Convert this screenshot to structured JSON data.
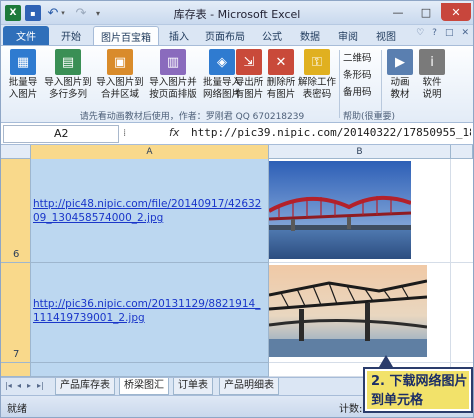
{
  "titlebar": {
    "title": "库存表 - Microsoft Excel",
    "min": "—",
    "max": "□",
    "close": "✕"
  },
  "qat": {
    "app": "X",
    "save": "▪",
    "undo": "↶",
    "redo": "↷",
    "more": "▾"
  },
  "tabs": [
    "文件",
    "开始",
    "图片百宝箱",
    "插入",
    "页面布局",
    "公式",
    "数据",
    "审阅",
    "视图"
  ],
  "ribbon_right": [
    "♡",
    "?",
    "□",
    "✕"
  ],
  "ribbon": {
    "buttons": [
      {
        "label": "批量导\n入图片",
        "color": "#2f7bd0"
      },
      {
        "label": "导入图片到\n多行多列",
        "color": "#3a8f55"
      },
      {
        "label": "导入图片到\n合并区域",
        "color": "#d98b2b"
      },
      {
        "label": "导入图片并\n按页面排版",
        "color": "#8a6bbd"
      },
      {
        "label": "批量导入\n网络图片",
        "color": "#2f7bd0"
      },
      {
        "label": "导出所\n有图片",
        "color": "#c94a3a"
      },
      {
        "label": "删除所\n有图片",
        "color": "#c94a3a"
      },
      {
        "label": "解除工作\n表密码",
        "color": "#e0b020"
      },
      {
        "label": "动画\n教材",
        "color": "#5a7fb0"
      },
      {
        "label": "软件\n说明",
        "color": "#7a7a7a"
      }
    ],
    "group_label": "请先看动画教材后使用，作者：罗刚君 QQ 670218239",
    "small_links": [
      "二维码",
      "条形码",
      "备用码"
    ],
    "help_label": "帮助(很重要)"
  },
  "formula_bar": {
    "name_box": "A2",
    "fx": "fx",
    "value": "http://pic39.nipic.com/20140322/17850955_180555"
  },
  "columns": [
    "A",
    "B"
  ],
  "rows": [
    {
      "num": "6",
      "url": "http://pic48.nipic.com/file/20140917/4263209_130458574000_2.jpg"
    },
    {
      "num": "7",
      "url": "http://pic36.nipic.com/20131129/8821914_111419739001_2.jpg"
    }
  ],
  "sheets": [
    "产品库存表",
    "桥梁图汇",
    "订单表",
    "产品明细表"
  ],
  "nav_buttons": [
    "|◂",
    "◂",
    "▸",
    "▸|"
  ],
  "status": {
    "ready": "就绪",
    "count": "计数: 15"
  },
  "callout": "2. 下载网络图片到单元格",
  "colors": {
    "accent": "#2f6fba",
    "selected_header": "#f9d98b",
    "selected_cell": "#bcd7f0",
    "link": "#1a36c9"
  }
}
